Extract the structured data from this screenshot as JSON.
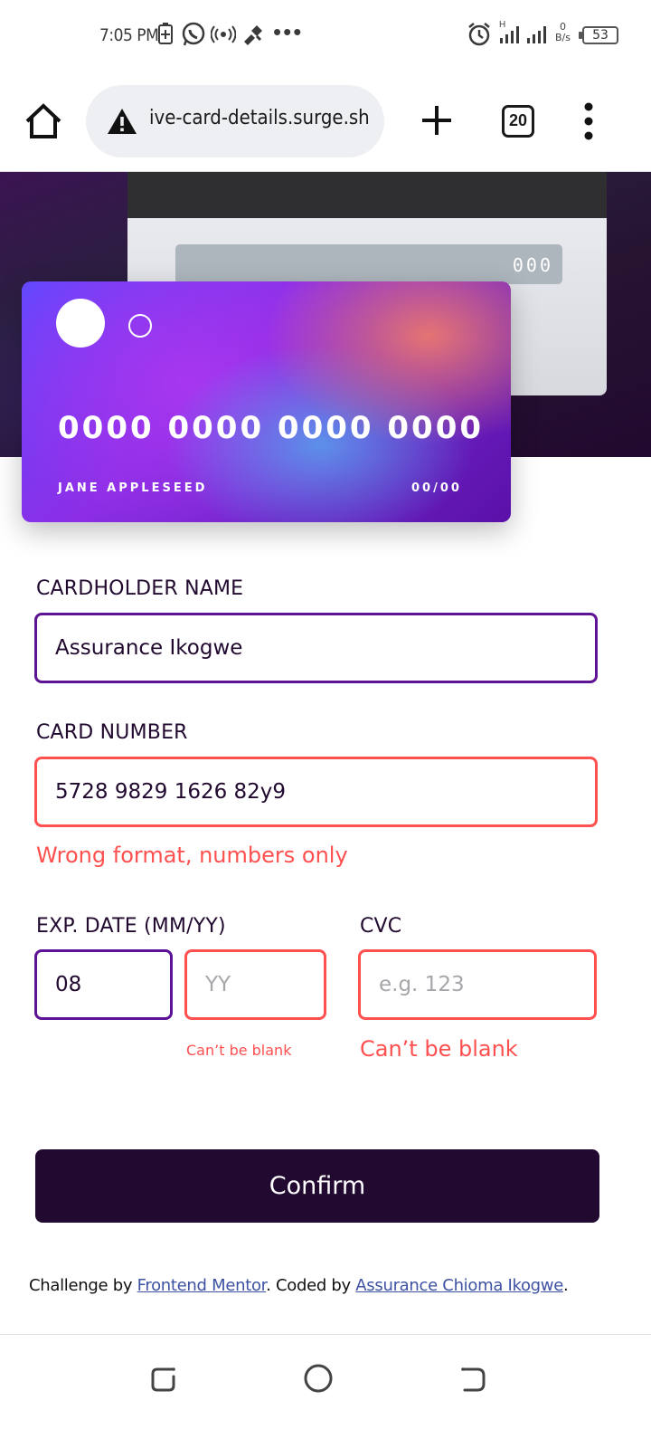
{
  "status_bar": {
    "time": "7:05 PM",
    "battery": "53",
    "net_speed_value": "0",
    "net_speed_unit": "B/s",
    "signal_label": "H",
    "more_dots": "•••"
  },
  "browser": {
    "url": "ive-card-details.surge.sh",
    "tab_count": "20"
  },
  "card": {
    "back_cvc": "000",
    "number": "0000 0000 0000 0000",
    "holder": "JANE APPLESEED",
    "expiry": "00/00"
  },
  "form": {
    "cardholder_label": "CARDHOLDER NAME",
    "cardholder_value": "Assurance Ikogwe",
    "number_label": "CARD NUMBER",
    "number_value": "5728 9829 1626 82y9",
    "number_error": "Wrong format, numbers only",
    "exp_label": "EXP. DATE (MM/YY)",
    "exp_month_value": "08",
    "exp_year_placeholder": "YY",
    "exp_error": "Can’t be blank",
    "cvc_label": "CVC",
    "cvc_placeholder": "e.g. 123",
    "cvc_error": "Can’t be blank",
    "confirm_label": "Confirm"
  },
  "attribution": {
    "prefix": "Challenge by ",
    "link1": "Frontend Mentor",
    "middle": ". Coded by ",
    "link2": "Assurance Chioma Ikogwe",
    "suffix": "."
  },
  "colors": {
    "dark_violet": "#21092f",
    "focus_border": "#5d1394",
    "error_red": "#ff5050",
    "link_blue": "#3e52a3"
  }
}
